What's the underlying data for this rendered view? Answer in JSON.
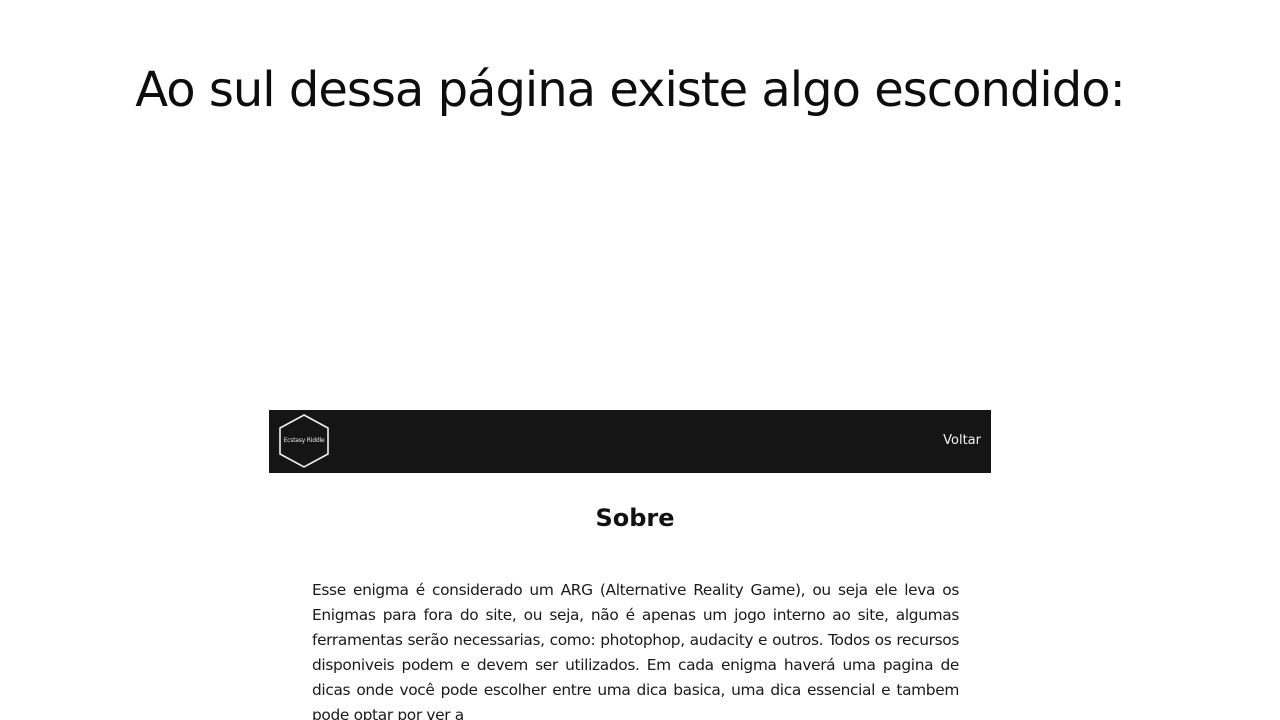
{
  "page": {
    "headline": "Ao sul dessa página existe algo escondido:"
  },
  "embed": {
    "navbar": {
      "logo_text": "Ecstasy Riddle",
      "logo_icon": "hexagon-logo-icon",
      "back_label": "Voltar"
    },
    "section_title": "Sobre",
    "about_text": "Esse enigma é considerado um ARG (Alternative Reality Game), ou seja ele leva os Enigmas para fora do site, ou seja, não é apenas um jogo interno ao site, algumas ferramentas serão necessarias, como: photophop, audacity e outros. Todos os recursos disponiveis podem e devem ser utilizados. Em cada enigma haverá uma pagina de dicas onde você pode escolher entre uma dica basica, uma dica essencial e tambem pode optar por ver a"
  },
  "colors": {
    "navbar_bg": "#151515",
    "page_bg": "#ffffff",
    "text": "#111111"
  }
}
